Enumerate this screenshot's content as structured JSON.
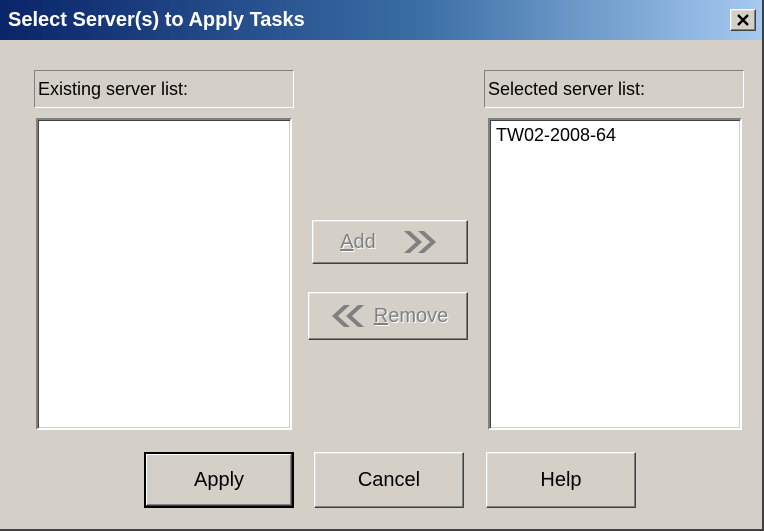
{
  "dialog": {
    "title": "Select Server(s) to Apply Tasks",
    "close_icon": "close-icon"
  },
  "existing": {
    "label": "Existing server list:",
    "items": []
  },
  "selected": {
    "label": "Selected server list:",
    "items": [
      "TW02-2008-64"
    ]
  },
  "transfer": {
    "add_label": "Add",
    "add_mnemonic": "A",
    "add_rest": "dd",
    "add_icon": "double-right-arrow-icon",
    "remove_label": "Remove",
    "remove_mnemonic": "R",
    "remove_rest": "emove",
    "remove_icon": "double-left-arrow-icon",
    "disabled": true
  },
  "footer": {
    "apply_label": "Apply",
    "cancel_label": "Cancel",
    "help_label": "Help"
  },
  "colors": {
    "face": "#d4d0c8",
    "titlebar_start": "#0a246a",
    "titlebar_end": "#a6caf0",
    "disabled_text": "#808080",
    "arrow_gray": "#808080"
  }
}
